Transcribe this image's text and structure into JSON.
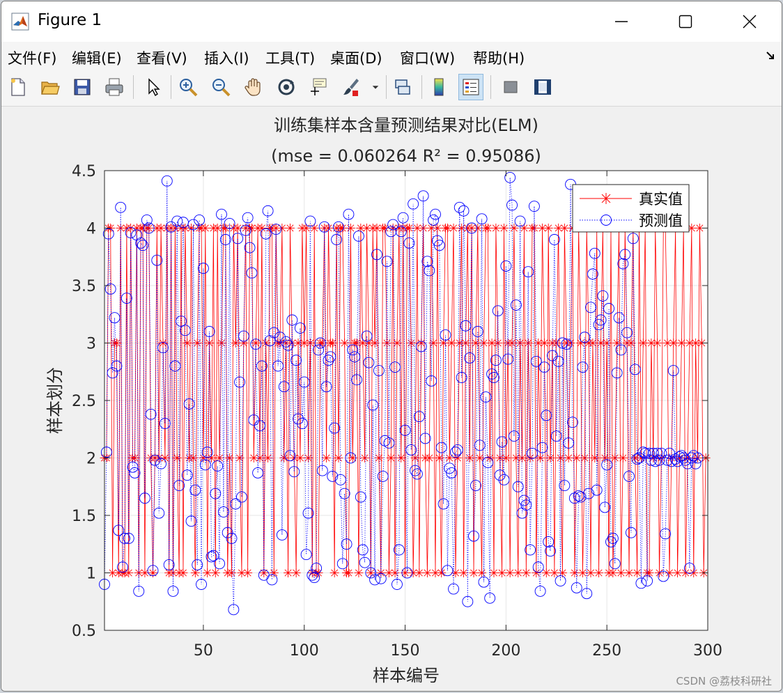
{
  "window": {
    "title": "Figure 1"
  },
  "menu": [
    "文件(F)",
    "编辑(E)",
    "查看(V)",
    "插入(I)",
    "工具(T)",
    "桌面(D)",
    "窗口(W)",
    "帮助(H)"
  ],
  "toolbar": [
    {
      "icon": "new-figure-icon"
    },
    {
      "icon": "open-file-icon"
    },
    {
      "icon": "save-icon"
    },
    {
      "icon": "print-icon"
    },
    {
      "icon": "select-arrow-icon"
    },
    {
      "icon": "zoom-in-icon"
    },
    {
      "icon": "zoom-out-icon"
    },
    {
      "icon": "pan-hand-icon"
    },
    {
      "icon": "rotate-3d-icon"
    },
    {
      "icon": "data-cursor-icon"
    },
    {
      "icon": "brush-icon"
    },
    {
      "icon": "brush-dropdown-icon"
    },
    {
      "icon": "link-plot-icon"
    },
    {
      "icon": "colorbar-icon"
    },
    {
      "icon": "legend-icon"
    },
    {
      "icon": "hide-plot-tools-icon"
    },
    {
      "icon": "show-plot-tools-icon"
    }
  ],
  "watermark": "CSDN @荔枝科研社",
  "colors": {
    "true_series": "#ff0000",
    "pred_series": "#0000ff",
    "axes_bg": "#ffffff",
    "figure_bg": "#f0f0f0"
  },
  "chart_data": {
    "type": "line",
    "title": "训练集样本含量预测结果对比(ELM)",
    "subtitle": "(mse = 0.060264 R² = 0.95086)",
    "xlabel": "样本编号",
    "ylabel": "样本划分",
    "xlim": [
      1,
      300
    ],
    "ylim": [
      0.5,
      4.5
    ],
    "xticks": [
      50,
      100,
      150,
      200,
      250,
      300
    ],
    "yticks": [
      0.5,
      1,
      1.5,
      2,
      2.5,
      3,
      3.5,
      4,
      4.5
    ],
    "grid": true,
    "legend_position": "top-right",
    "series": [
      {
        "name": "真实值",
        "marker": "asterisk",
        "line": "solid",
        "values": [
          2,
          2,
          4,
          4,
          1,
          3,
          3,
          1,
          4,
          1,
          1,
          4,
          1,
          4,
          2,
          2,
          4,
          1,
          4,
          4,
          1,
          4,
          4,
          2,
          1,
          2,
          4,
          2,
          4,
          3,
          2,
          4,
          1,
          4,
          1,
          4,
          2,
          1,
          4,
          1,
          4,
          3,
          2,
          4,
          2,
          1,
          3,
          4,
          4,
          2,
          4,
          1,
          3,
          2,
          4,
          1,
          4,
          2,
          3,
          4,
          4,
          1,
          2,
          1,
          4,
          3,
          4,
          2,
          1,
          3,
          4,
          1,
          4,
          4,
          2,
          3,
          4,
          2,
          4,
          1,
          3,
          2,
          4,
          4,
          1,
          4,
          3,
          3,
          4,
          2,
          3,
          1,
          4,
          3,
          2,
          1,
          3,
          2,
          4,
          3,
          4,
          2,
          3,
          1,
          4,
          1,
          1,
          3,
          3,
          4,
          2,
          4,
          3,
          3,
          1,
          4,
          2,
          4,
          4,
          3,
          1,
          1,
          4,
          2,
          3,
          3,
          1,
          4,
          3,
          2,
          4,
          3,
          1,
          4,
          3,
          4,
          2,
          1,
          4,
          4,
          3,
          1,
          2,
          4,
          1,
          3,
          4,
          2,
          4,
          1,
          4,
          4,
          3,
          1,
          2,
          4,
          1,
          3,
          4,
          2,
          1,
          2,
          4,
          3,
          1,
          4,
          2,
          1,
          3,
          4,
          4,
          2,
          3,
          4,
          1,
          2,
          3,
          4,
          1,
          3,
          4,
          2,
          4,
          1,
          3,
          4,
          2,
          1,
          3,
          4,
          4,
          2,
          3,
          1,
          4,
          3,
          2,
          1,
          4,
          2,
          3,
          1,
          3,
          4,
          2,
          1,
          3,
          2,
          4,
          1,
          3,
          2,
          4,
          4,
          1,
          3,
          2,
          4,
          3,
          1,
          4,
          2,
          3,
          1,
          3,
          4,
          2,
          1,
          4,
          3,
          2,
          3,
          4,
          1,
          2,
          4,
          3,
          1,
          2,
          4,
          3,
          1,
          3,
          2,
          4,
          1,
          3,
          4,
          2,
          3,
          1,
          4,
          1,
          2,
          3,
          4,
          1,
          2,
          4,
          3,
          1,
          3,
          4,
          2,
          1,
          4,
          2,
          3,
          4,
          1,
          1,
          3,
          2,
          4,
          3,
          1,
          2,
          4,
          4,
          3,
          1,
          2,
          3,
          4,
          1,
          2,
          3,
          4,
          1,
          2,
          3,
          4,
          1,
          3,
          2,
          4,
          3,
          1,
          2
        ]
      },
      {
        "name": "预测值",
        "marker": "circle",
        "line": "dotted",
        "values": [
          0.9,
          2.05,
          3.95,
          3.47,
          2.74,
          3.22,
          2.8,
          1.37,
          4.18,
          1.05,
          1.3,
          3.39,
          1.3,
          3.96,
          1.92,
          1.87,
          3.94,
          0.84,
          3.87,
          3.85,
          1.65,
          4.07,
          4,
          2.38,
          1.02,
          1.98,
          3.72,
          1.52,
          1.95,
          2.96,
          2.3,
          4.41,
          1.07,
          4.01,
          0.84,
          2.8,
          4.06,
          1.76,
          3.19,
          4.05,
          3.11,
          1.85,
          2.47,
          1.45,
          4.03,
          1.72,
          1.07,
          4.07,
          0.9,
          3.65,
          1.94,
          2.05,
          3.1,
          1.14,
          1.15,
          1.69,
          1.93,
          1.08,
          4.12,
          1.53,
          3.9,
          1.35,
          4.04,
          1.3,
          0.68,
          1.6,
          3.91,
          2.66,
          1.66,
          3.06,
          3.98,
          4.09,
          3.83,
          3.61,
          2.33,
          2.99,
          1.87,
          2.28,
          2.8,
          0.98,
          3.95,
          4.15,
          3.02,
          0.94,
          3.09,
          3.99,
          2.8,
          3.05,
          1.33,
          2.62,
          3.01,
          2.98,
          2.02,
          3.2,
          1.88,
          2.85,
          2.34,
          3.13,
          2.3,
          2.66,
          1.16,
          1.52,
          4.06,
          0.98,
          0.96,
          1.04,
          2.94,
          3,
          1.89,
          4.01,
          2.62,
          2.85,
          2.88,
          1.84,
          2.26,
          3.9,
          4.01,
          1.81,
          1.08,
          1.69,
          1.25,
          4.12,
          2,
          2.94,
          2.88,
          2.68,
          3.93,
          1.66,
          1.2,
          1.09,
          3.06,
          2.83,
          1,
          2.46,
          0.94,
          3.77,
          2.76,
          0.95,
          1.84,
          2.15,
          3.71,
          2.13,
          3.97,
          4.03,
          2.79,
          0.9,
          1.2,
          3.97,
          4.09,
          2.24,
          1,
          3.87,
          2.07,
          4.21,
          1.89,
          1.86,
          2.36,
          2.97,
          4.28,
          2.17,
          3.71,
          3.63,
          2.67,
          4.07,
          4.12,
          3.89,
          3.85,
          2.09,
          1.6,
          3.07,
          1.02,
          1.91,
          1.87,
          0.86,
          2.05,
          2.07,
          4.18,
          2.7,
          4.15,
          3.15,
          0.75,
          2.87,
          4,
          1.32,
          1.76,
          3.1,
          2.11,
          4.08,
          0.92,
          2.53,
          1.96,
          0.78,
          2.73,
          2.7,
          2.85,
          3.28,
          1.85,
          2.14,
          1.81,
          3.67,
          2.86,
          4.44,
          4.2,
          2.19,
          3.33,
          1.75,
          4.06,
          1.52,
          1.63,
          1.59,
          3.62,
          1.2,
          2.04,
          4.19,
          2.84,
          1.05,
          0.84,
          2.09,
          2.79,
          2.37,
          1.27,
          1.19,
          2.89,
          3.9,
          2.19,
          2.84,
          0.93,
          3,
          1.76,
          2.99,
          2.13,
          4.38,
          2.31,
          1.65,
          0.87,
          1.67,
          1.66,
          2.79,
          3.05,
          0.82,
          1.69,
          3.31,
          3.6,
          3.78,
          1.72,
          3.16,
          3.2,
          3.41,
          1.57,
          1.94,
          3.3,
          1.27,
          1.3,
          1.08,
          2.74,
          3.22,
          2.94,
          3.69,
          3.77,
          3.09,
          1.84,
          1.35,
          3.91,
          2.77,
          1.99,
          2,
          0.91,
          2.05,
          2.04,
          0.93,
          2.04,
          1.98,
          2.04,
          1.97,
          2.04,
          1.98,
          2.04,
          0.97,
          1.34,
          1.98,
          2.04,
          1.97,
          2.76,
          1.99,
          1.97,
          2.01,
          2.02,
          2.0,
          1.98,
          1.95,
          1.04,
          2.0,
          2.02,
          1.95,
          2.0
        ]
      }
    ]
  }
}
